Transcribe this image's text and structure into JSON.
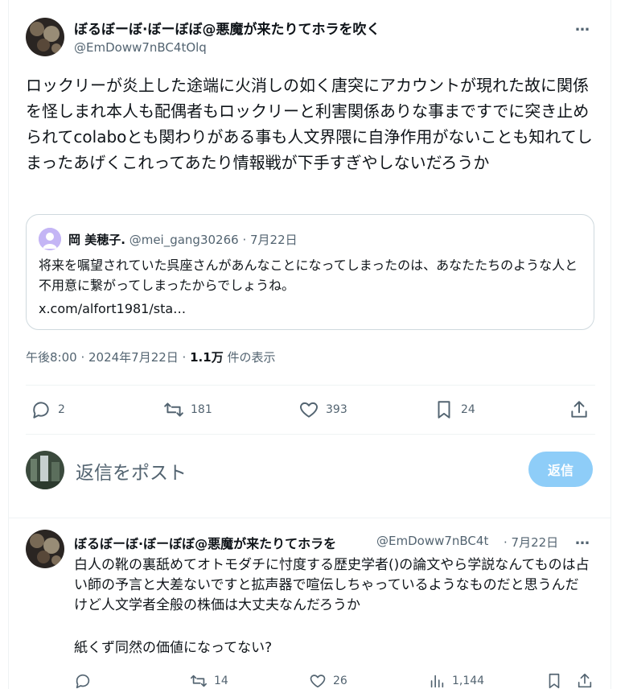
{
  "main_post": {
    "author_name": "ぼるぼーぼ·ぼーぼぼ@悪魔が来たりてホラを吹く",
    "author_handle": "@EmDoww7nBC4tOlq",
    "more_icon": "…",
    "text": "ロックリーが炎上した途端に火消しの如く唐突にアカウントが現れた故に関係を怪しまれ本人も配偶者もロックリーと利害関係ありな事まですでに突き止められてcolaboとも関わりがある事も人文界隈に自浄作用がないことも知れてしまったあげくこれってあたり情報戦が下手すぎやしないだろうか",
    "quote": {
      "author_name": "岡 美穂子.",
      "author_handle": "@mei_gang30266",
      "date": "· 7月22日",
      "text": "将来を嘱望されていた呉座さんがあんなことになってしまったのは、あなたたちのような人と不用意に繋がってしまったからでしょうね。",
      "link": "x.com/alfort1981/sta…"
    },
    "meta": {
      "time": "午後8:00 · 2024年7月22日 ·",
      "views": "1.1万",
      "views_label": "件の表示"
    },
    "actions": {
      "replies": "2",
      "reposts": "181",
      "likes": "393",
      "bookmarks": "24"
    }
  },
  "reply_box": {
    "placeholder": "返信をポスト",
    "button_label": "返信"
  },
  "reply_post": {
    "author_name": "ぼるぼーぼ·ぼーぼぼ@悪魔が来たりてホラを",
    "author_handle": "@EmDoww7nBC4t",
    "date": "· 7月22日",
    "more_icon": "…",
    "text_line1": "白人の靴の裏舐めてオトモダチに忖度する歴史学者()の論文やら学説なんてものは占い師の予言と大差ないですと拡声器で喧伝しちゃっているようなものだと思うんだけど人文学者全般の株価は大丈夫なんだろうか",
    "text_line2": "紙くず同然の価値になってない?",
    "actions": {
      "replies": "",
      "reposts": "14",
      "likes": "26",
      "views": "1,144"
    }
  },
  "colors": {
    "accent": "#1d9bf0",
    "reply_button_disabled": "#8ecdf8",
    "secondary_text": "#536471",
    "border": "#eff3f4"
  }
}
